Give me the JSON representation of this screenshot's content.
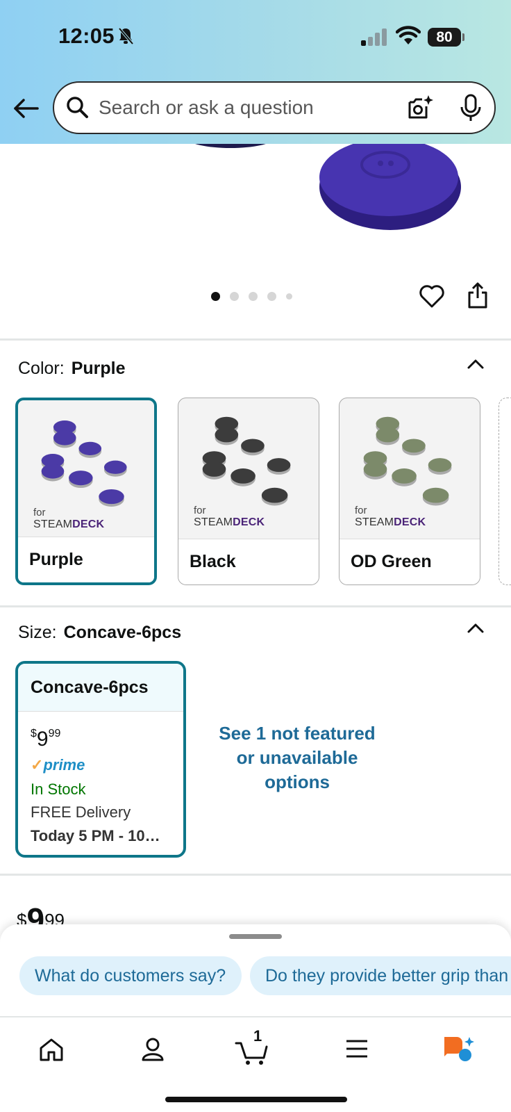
{
  "status": {
    "time": "12:05",
    "battery": "80"
  },
  "search": {
    "placeholder": "Search or ask a question"
  },
  "gallery": {
    "image_count": 5,
    "active_index": 0
  },
  "color": {
    "label": "Color:",
    "selected": "Purple",
    "options": [
      {
        "name": "Purple",
        "brand_small": "for",
        "brand_a": "STEAM",
        "brand_b": "DECK"
      },
      {
        "name": "Black",
        "brand_small": "for",
        "brand_a": "STEAM",
        "brand_b": "DECK"
      },
      {
        "name": "OD Green",
        "brand_small": "for",
        "brand_a": "STEAM",
        "brand_b": "DECK"
      }
    ],
    "swatch_colors": {
      "Purple": "#4b3aa6",
      "Black": "#3c3c3c",
      "OD Green": "#7c8a6a"
    }
  },
  "size": {
    "label": "Size:",
    "selected": "Concave-6pcs",
    "card": {
      "name": "Concave-6pcs",
      "currency": "$",
      "price_whole": "9",
      "price_fraction": "99",
      "prime_check": "✓",
      "prime": "prime",
      "stock": "In Stock",
      "delivery": "FREE Delivery",
      "delivery_time": "Today 5 PM - 10…"
    },
    "see_more": "See 1 not featured or unavailable options"
  },
  "bottom_price": {
    "currency": "$",
    "whole": "9",
    "fraction": "99"
  },
  "suggestions": [
    "What do customers say?",
    "Do they provide better grip than"
  ],
  "nav": {
    "cart_count": "1"
  },
  "colors": {
    "accent": "#0e7689",
    "link": "#1e6a97",
    "stock": "#007600",
    "prime": "#1f8fc6",
    "product": "#4b3aa6"
  }
}
